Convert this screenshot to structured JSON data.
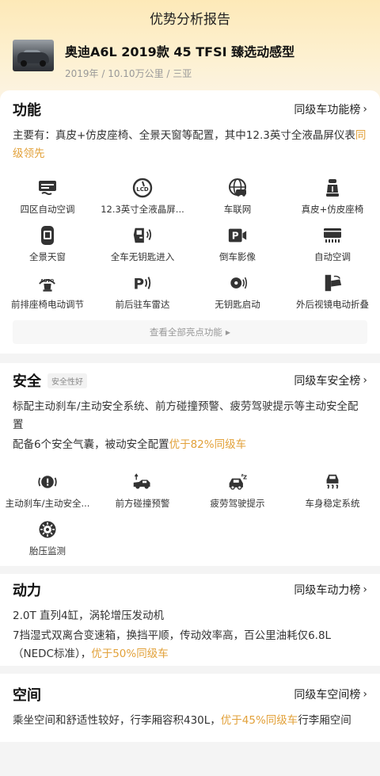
{
  "header": {
    "title": "优势分析报告",
    "car_name": "奥迪A6L 2019款 45 TFSI 臻选动感型",
    "car_meta": "2019年 / 10.10万公里 / 三亚"
  },
  "function": {
    "title": "功能",
    "link": "同级车功能榜",
    "desc_main": "主要有：真皮+仿皮座椅、全景天窗等配置，其中12.3英寸全液晶屏仪表",
    "desc_highlight": "同级领先",
    "features": [
      {
        "label": "四区自动空调",
        "icon": "four-zone-ac-icon"
      },
      {
        "label": "12.3英寸全液晶屏...",
        "icon": "lcd-icon"
      },
      {
        "label": "车联网",
        "icon": "car-network-icon"
      },
      {
        "label": "真皮+仿皮座椅",
        "icon": "leather-seat-icon"
      },
      {
        "label": "全景天窗",
        "icon": "panoramic-sunroof-icon"
      },
      {
        "label": "全车无钥匙进入",
        "icon": "keyless-entry-icon"
      },
      {
        "label": "倒车影像",
        "icon": "reverse-camera-icon"
      },
      {
        "label": "自动空调",
        "icon": "auto-ac-icon"
      },
      {
        "label": "前排座椅电动调节",
        "icon": "power-seat-icon"
      },
      {
        "label": "前后驻车雷达",
        "icon": "parking-radar-icon"
      },
      {
        "label": "无钥匙启动",
        "icon": "keyless-start-icon"
      },
      {
        "label": "外后视镜电动折叠",
        "icon": "mirror-fold-icon"
      }
    ],
    "more": "查看全部亮点功能"
  },
  "safety": {
    "title": "安全",
    "tag": "安全性好",
    "link": "同级车安全榜",
    "desc1": "标配主动刹车/主动安全系统、前方碰撞预警、疲劳驾驶提示等主动安全配置",
    "desc2_main": "配备6个安全气囊，被动安全配置",
    "desc2_highlight": "优于82%同级车",
    "features": [
      {
        "label": "主动刹车/主动安全...",
        "icon": "active-brake-icon"
      },
      {
        "label": "前方碰撞预警",
        "icon": "collision-warning-icon"
      },
      {
        "label": "疲劳驾驶提示",
        "icon": "fatigue-alert-icon"
      },
      {
        "label": "车身稳定系统",
        "icon": "stability-control-icon"
      },
      {
        "label": "胎压监测",
        "icon": "tire-pressure-icon"
      }
    ]
  },
  "power": {
    "title": "动力",
    "link": "同级车动力榜",
    "desc1": "2.0T 直列4缸，涡轮增压发动机",
    "desc2_main": "7挡湿式双离合变速箱，换挡平顺，传动效率高，百公里油耗仅6.8L（NEDC标准），",
    "desc2_highlight": "优于50%同级车"
  },
  "space": {
    "title": "空间",
    "link": "同级车空间榜",
    "desc_main": "乘坐空间和舒适性较好，行李厢容积430L，",
    "desc_highlight": "优于45%同级车",
    "desc_tail": "行李厢空间"
  }
}
